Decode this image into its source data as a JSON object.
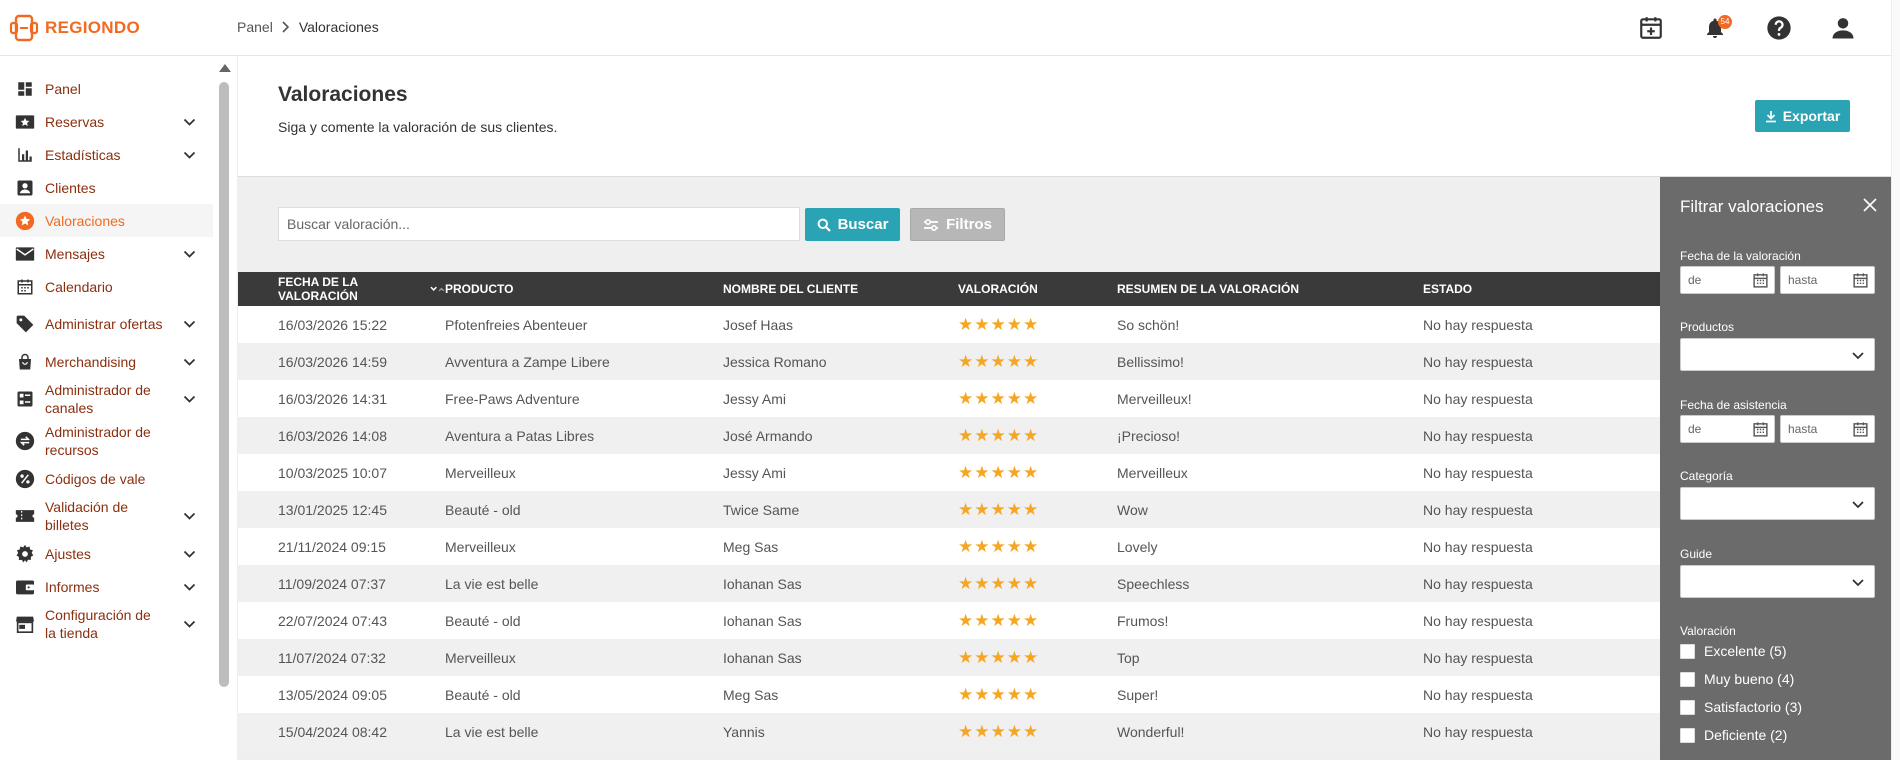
{
  "brand": {
    "name": "REGIONDO",
    "color": "#f26a21"
  },
  "breadcrumb": {
    "root": "Panel",
    "current": "Valoraciones"
  },
  "topbar": {
    "notification_count": "54"
  },
  "sidebar": {
    "items": [
      {
        "label": "Panel",
        "icon": "dashboard-icon",
        "expandable": false,
        "active": false
      },
      {
        "label": "Reservas",
        "icon": "star-ticket-icon",
        "expandable": true,
        "active": false
      },
      {
        "label": "Estadísticas",
        "icon": "bar-chart-icon",
        "expandable": true,
        "active": false
      },
      {
        "label": "Clientes",
        "icon": "contact-icon",
        "expandable": false,
        "active": false
      },
      {
        "label": "Valoraciones",
        "icon": "star-circle-icon",
        "expandable": false,
        "active": true
      },
      {
        "label": "Mensajes",
        "icon": "mail-icon",
        "expandable": true,
        "active": false
      },
      {
        "label": "Calendario",
        "icon": "calendar-icon",
        "expandable": false,
        "active": false
      },
      {
        "label": "Administrar ofertas",
        "icon": "tag-icon",
        "expandable": true,
        "active": false
      },
      {
        "label": "Merchandising",
        "icon": "shopping-bag-icon",
        "expandable": true,
        "active": false
      },
      {
        "label": "Administrador de canales",
        "icon": "channels-icon",
        "expandable": true,
        "active": false
      },
      {
        "label": "Administrador de recursos",
        "icon": "resources-icon",
        "expandable": false,
        "active": false
      },
      {
        "label": "Códigos de vale",
        "icon": "percent-icon",
        "expandable": false,
        "active": false
      },
      {
        "label": "Validación de billetes",
        "icon": "ticket-icon",
        "expandable": true,
        "active": false
      },
      {
        "label": "Ajustes",
        "icon": "gear-icon",
        "expandable": true,
        "active": false
      },
      {
        "label": "Informes",
        "icon": "wallet-icon",
        "expandable": true,
        "active": false
      },
      {
        "label": "Configuración de la tienda",
        "icon": "store-icon",
        "expandable": true,
        "active": false
      }
    ]
  },
  "page": {
    "title": "Valoraciones",
    "subtitle": "Siga y comente la valoración de sus clientes.",
    "export_label": "Exportar"
  },
  "search": {
    "placeholder": "Buscar valoración...",
    "search_label": "Buscar",
    "filters_label": "Filtros"
  },
  "table": {
    "columns": [
      "Fecha de la valoración",
      "Producto",
      "Nombre del cliente",
      "Valoración",
      "Resumen de la valoración",
      "Estado"
    ],
    "rows": [
      {
        "date": "16/03/2026 15:22",
        "product": "Pfotenfreies Abenteuer",
        "customer": "Josef Haas",
        "rating": 5,
        "summary": "So schön!",
        "status": "No hay respuesta"
      },
      {
        "date": "16/03/2026 14:59",
        "product": "Avventura a Zampe Libere",
        "customer": "Jessica Romano",
        "rating": 5,
        "summary": "Bellissimo!",
        "status": "No hay respuesta"
      },
      {
        "date": "16/03/2026 14:31",
        "product": "Free-Paws Adventure",
        "customer": "Jessy Ami",
        "rating": 5,
        "summary": "Merveilleux!",
        "status": "No hay respuesta"
      },
      {
        "date": "16/03/2026 14:08",
        "product": "Aventura a Patas Libres",
        "customer": "José Armando",
        "rating": 5,
        "summary": "¡Precioso!",
        "status": "No hay respuesta"
      },
      {
        "date": "10/03/2025 10:07",
        "product": "Merveilleux",
        "customer": "Jessy Ami",
        "rating": 5,
        "summary": "Merveilleux",
        "status": "No hay respuesta"
      },
      {
        "date": "13/01/2025 12:45",
        "product": "Beauté - old",
        "customer": "Twice Same",
        "rating": 5,
        "summary": "Wow",
        "status": "No hay respuesta"
      },
      {
        "date": "21/11/2024 09:15",
        "product": "Merveilleux",
        "customer": "Meg Sas",
        "rating": 5,
        "summary": "Lovely",
        "status": "No hay respuesta"
      },
      {
        "date": "11/09/2024 07:37",
        "product": "La vie est belle",
        "customer": "Iohanan Sas",
        "rating": 5,
        "summary": "Speechless",
        "status": "No hay respuesta"
      },
      {
        "date": "22/07/2024 07:43",
        "product": "Beauté - old",
        "customer": "Iohanan Sas",
        "rating": 5,
        "summary": "Frumos!",
        "status": "No hay respuesta"
      },
      {
        "date": "11/07/2024 07:32",
        "product": "Merveilleux",
        "customer": "Iohanan Sas",
        "rating": 5,
        "summary": "Top",
        "status": "No hay respuesta"
      },
      {
        "date": "13/05/2024 09:05",
        "product": "Beauté - old",
        "customer": "Meg Sas",
        "rating": 5,
        "summary": "Super!",
        "status": "No hay respuesta"
      },
      {
        "date": "15/04/2024 08:42",
        "product": "La vie est belle",
        "customer": "Yannis",
        "rating": 5,
        "summary": "Wonderful!",
        "status": "No hay respuesta"
      }
    ]
  },
  "filter_panel": {
    "title": "Filtrar valoraciones",
    "review_date_label": "Fecha de la valoración",
    "from_placeholder": "de",
    "to_placeholder": "hasta",
    "products_label": "Productos",
    "attendance_date_label": "Fecha de asistencia",
    "category_label": "Categoría",
    "guide_label": "Guide",
    "rating_label": "Valoración",
    "rating_options": [
      "Excelente (5)",
      "Muy bueno (4)",
      "Satisfactorio (3)",
      "Deficiente (2)"
    ]
  },
  "colors": {
    "accent": "#2aa3b5",
    "star": "#f5a623",
    "table_header": "#3a3a3a",
    "panel": "#6b6b6b"
  }
}
